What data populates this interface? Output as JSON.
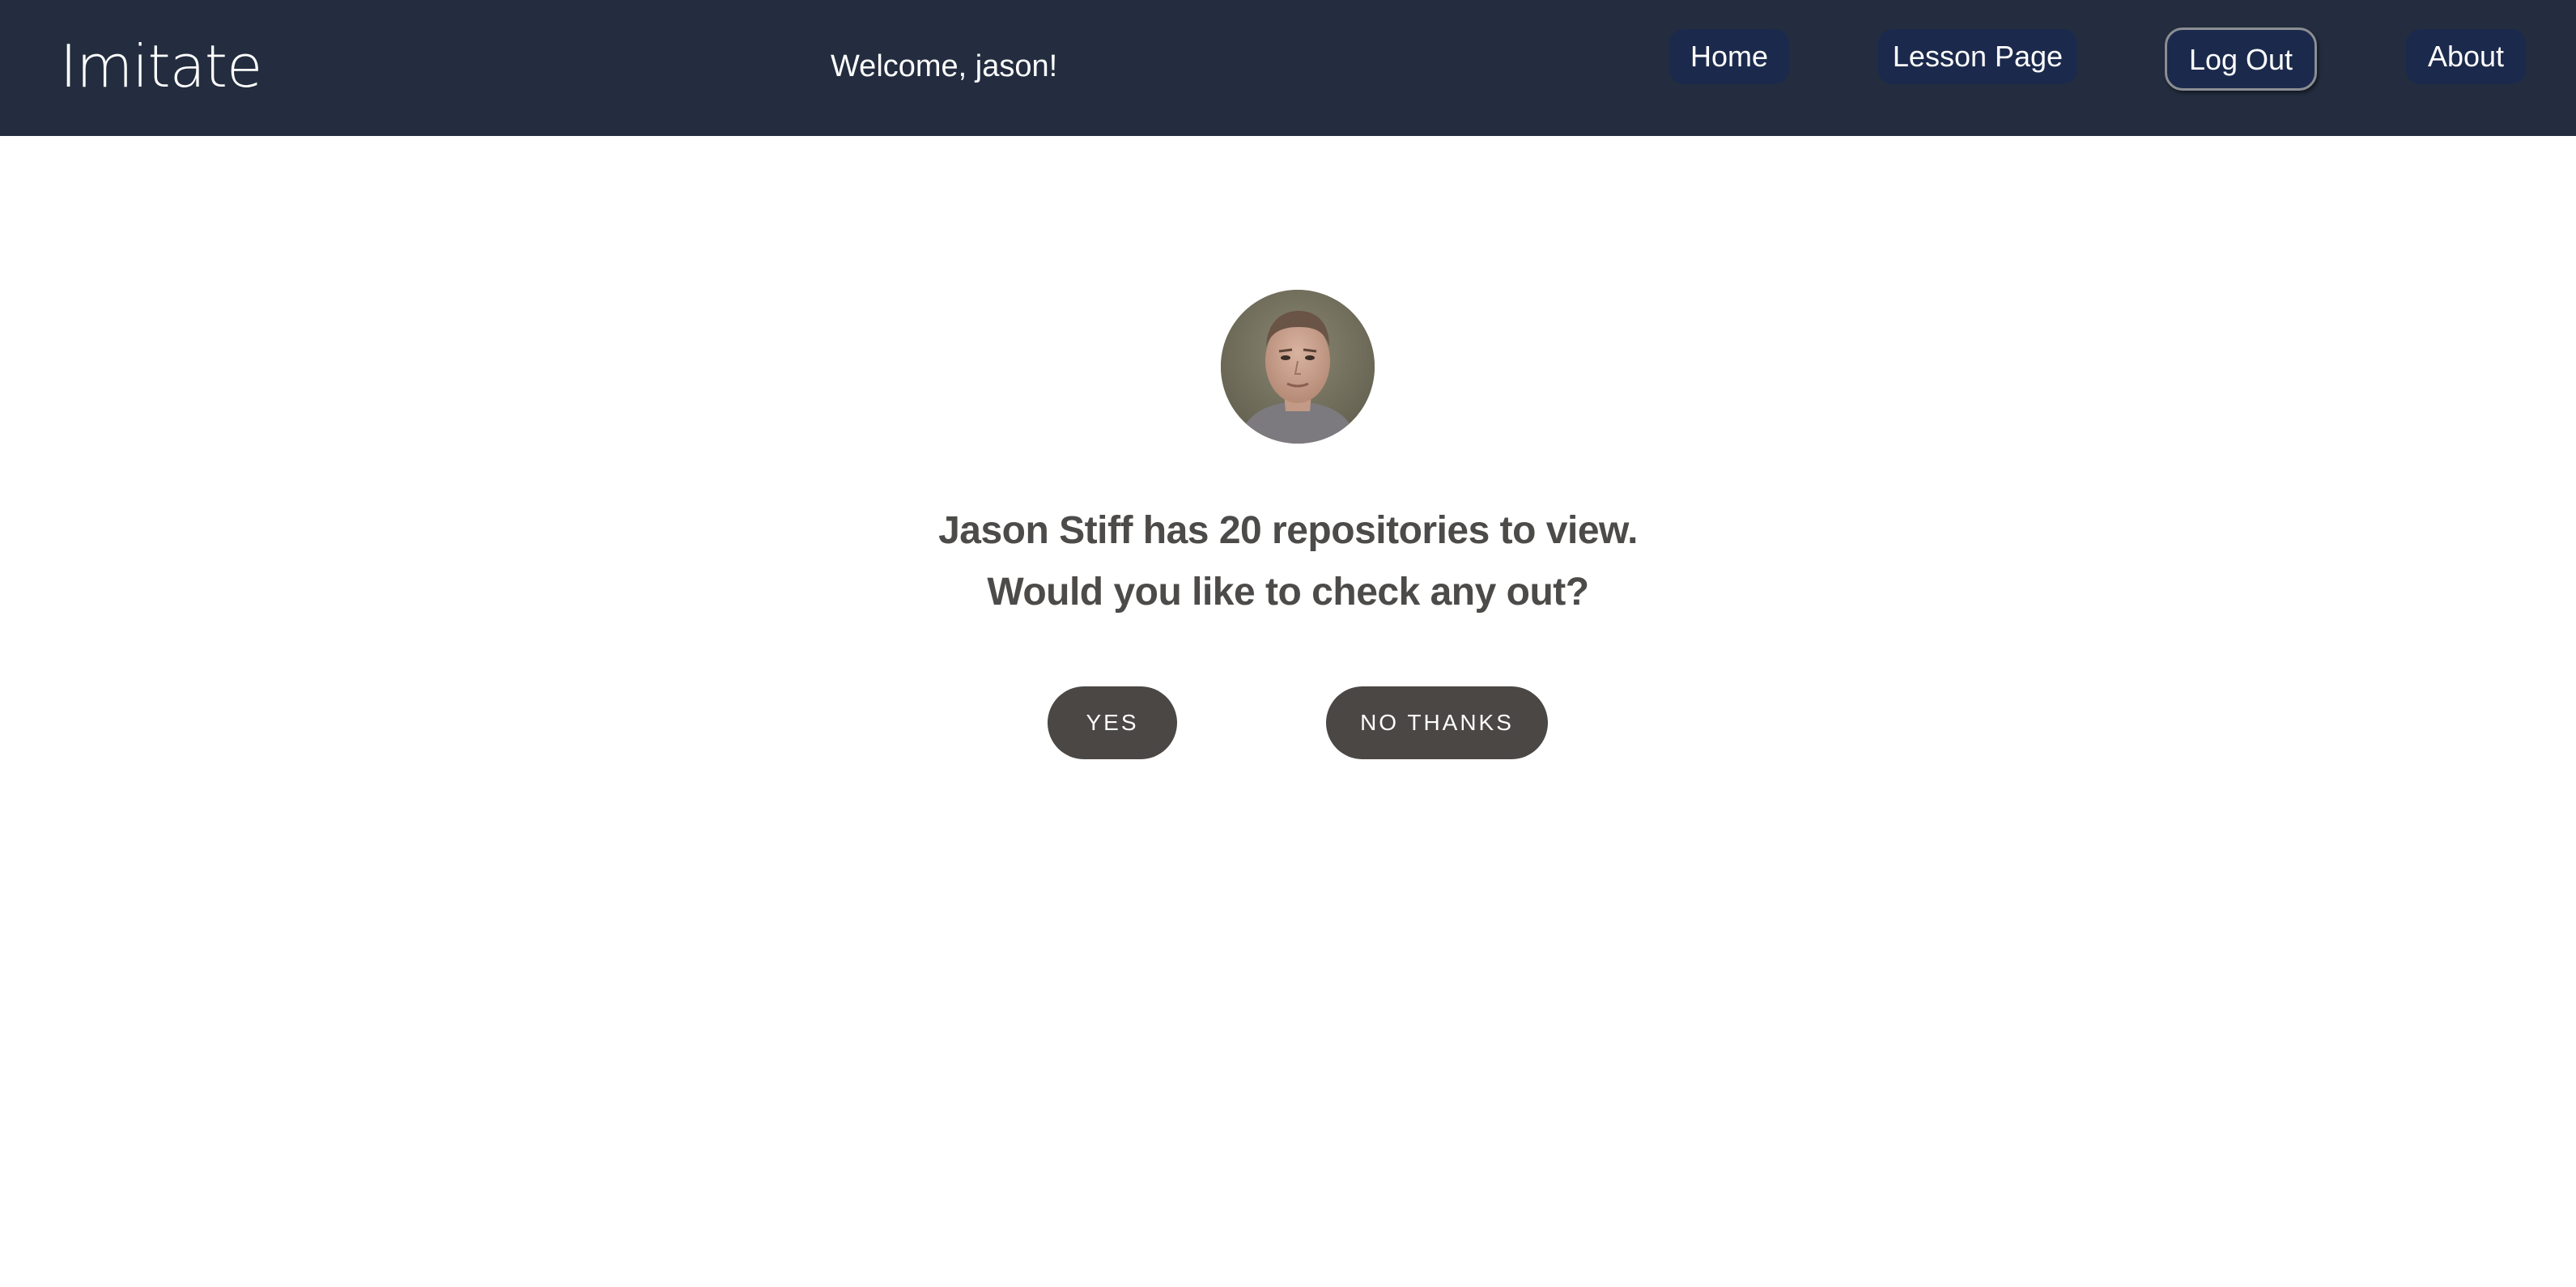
{
  "header": {
    "brand": "Imitate",
    "welcome": "Welcome, jason!",
    "nav": {
      "home": "Home",
      "lesson": "Lesson Page",
      "logout": "Log Out",
      "about": "About"
    }
  },
  "main": {
    "headline_line1": "Jason Stiff has 20 repositories to view.",
    "headline_line2": "Would you like to check any out?",
    "yes_label": "YES",
    "no_label": "NO THANKS"
  },
  "colors": {
    "navbar_bg": "#232d3f",
    "nav_button_bg": "#1b2a4c",
    "pill_bg": "#4a4744",
    "headline_text": "#4d4b49"
  }
}
